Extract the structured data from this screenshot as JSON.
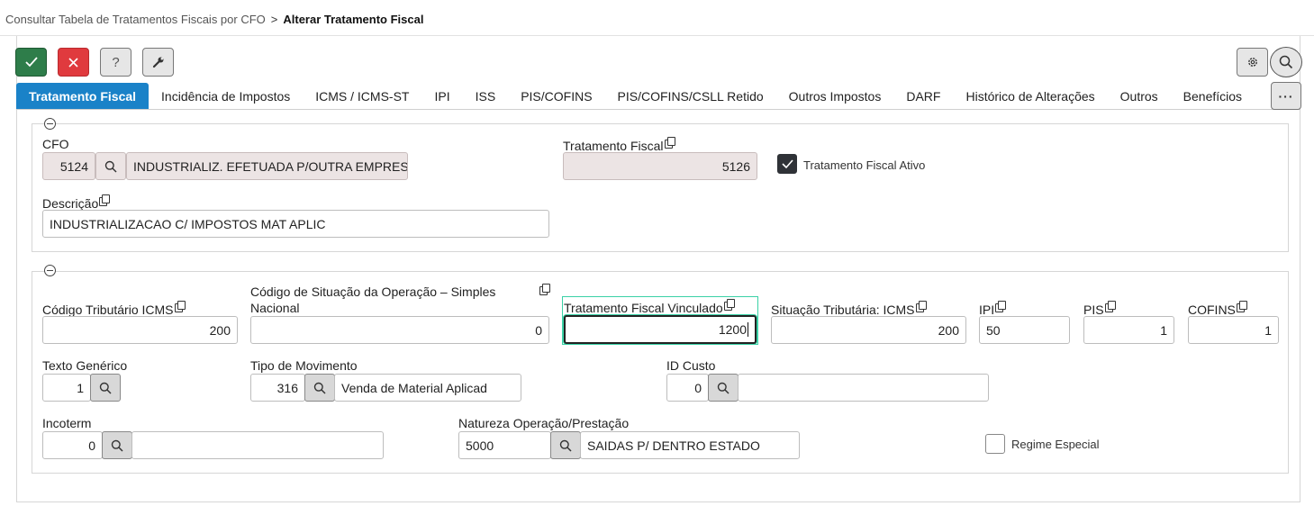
{
  "breadcrumb": {
    "parent": "Consultar Tabela de Tratamentos Fiscais por CFO",
    "separator": ">",
    "current": "Alterar Tratamento Fiscal"
  },
  "toolbar": {
    "confirm_icon": "check-icon",
    "cancel_icon": "close-icon",
    "help_label": "?",
    "tools_icon": "wrench-icon",
    "settings_icon": "gear-icon",
    "search_icon": "search-icon"
  },
  "tabs": [
    {
      "label": "Tratamento Fiscal",
      "active": true
    },
    {
      "label": "Incidência de Impostos"
    },
    {
      "label": "ICMS / ICMS-ST"
    },
    {
      "label": "IPI"
    },
    {
      "label": "ISS"
    },
    {
      "label": "PIS/COFINS"
    },
    {
      "label": "PIS/COFINS/CSLL Retido"
    },
    {
      "label": "Outros Impostos"
    },
    {
      "label": "DARF"
    },
    {
      "label": "Histórico de Alterações"
    },
    {
      "label": "Outros"
    },
    {
      "label": "Benefícios"
    }
  ],
  "more_label": "···",
  "section1": {
    "cfo": {
      "label": "CFO",
      "code": "5124",
      "description": "INDUSTRIALIZ. EFETUADA P/OUTRA EMPRESA"
    },
    "tratamento_fiscal": {
      "label": "Tratamento Fiscal",
      "value": "5126"
    },
    "ativo": {
      "label": "Tratamento Fiscal Ativo",
      "checked": true
    },
    "descricao": {
      "label": "Descrição",
      "value": "INDUSTRIALIZACAO C/ IMPOSTOS MAT APLIC"
    }
  },
  "section2": {
    "codigo_tributario_icms": {
      "label": "Código Tributário ICMS",
      "value": "200"
    },
    "csosn": {
      "label_line1": "Código de Situação da Operação – Simples",
      "label_line2": "Nacional",
      "value": "0"
    },
    "tf_vinculado": {
      "label": "Tratamento Fiscal Vinculado",
      "value": "1200"
    },
    "situacao_icms": {
      "label": "Situação Tributária: ICMS",
      "value": "200"
    },
    "ipi": {
      "label": "IPI",
      "value": "50"
    },
    "pis": {
      "label": "PIS",
      "value": "1"
    },
    "cofins": {
      "label": "COFINS",
      "value": "1"
    },
    "texto_generico": {
      "label": "Texto Genérico",
      "value": "1"
    },
    "tipo_movimento": {
      "label": "Tipo de Movimento",
      "code": "316",
      "description": "Venda de Material Aplicad"
    },
    "id_custo": {
      "label": "ID Custo",
      "code": "0",
      "description": ""
    },
    "incoterm": {
      "label": "Incoterm",
      "code": "0",
      "description": ""
    },
    "natureza": {
      "label": "Natureza Operação/Prestação",
      "code": "5000",
      "description": "SAIDAS P/ DENTRO ESTADO"
    },
    "regime_especial": {
      "label": "Regime Especial",
      "checked": false
    }
  },
  "colors": {
    "accent": "#1a82c8",
    "confirm": "#2e7d4a",
    "cancel": "#e03a3e",
    "readonly_bg": "#ece4e4",
    "focus_ring": "#3ad1a6"
  }
}
